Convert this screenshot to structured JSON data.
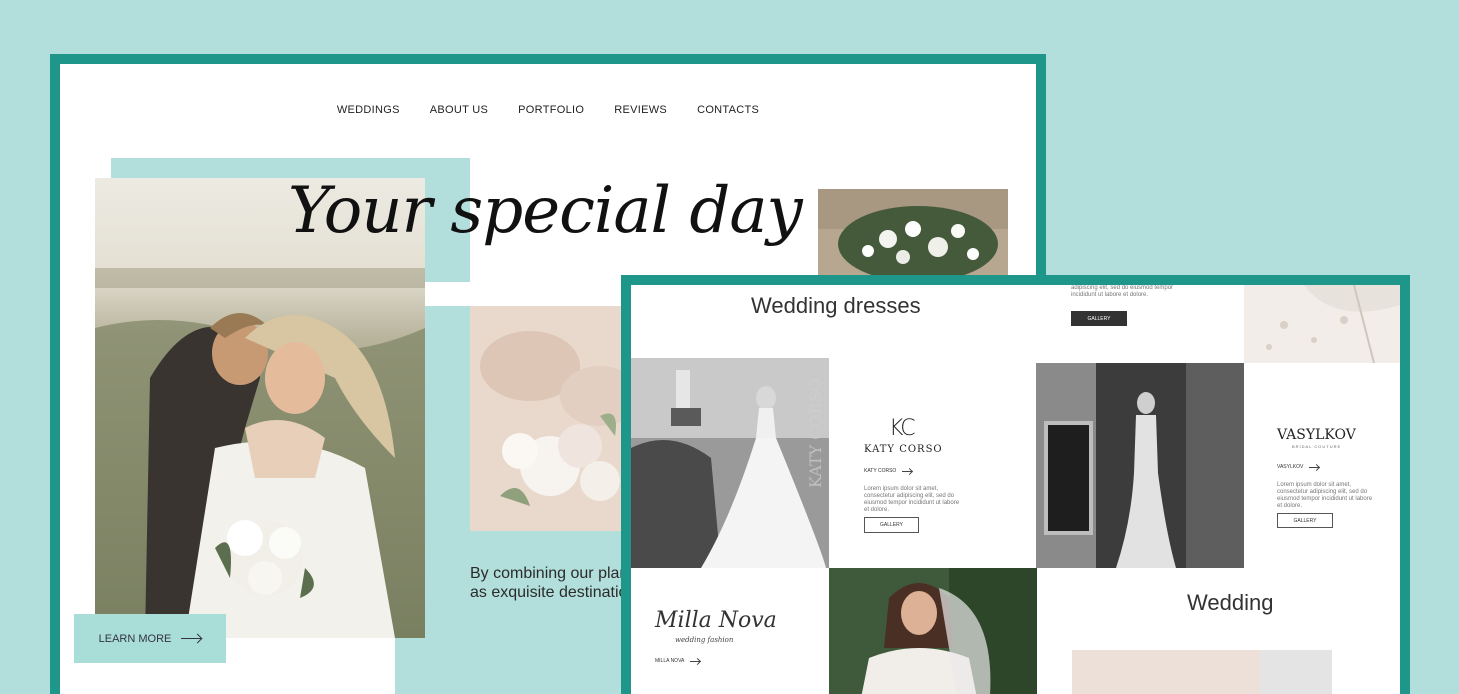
{
  "nav": {
    "items": [
      "WEDDINGS",
      "ABOUT US",
      "PORTFOLIO",
      "REVIEWS",
      "CONTACTS"
    ]
  },
  "hero": {
    "title": "Your special day",
    "intro": "By combining our plan vision, you can rest as exquisite destination",
    "learn_more": "LEARN MORE"
  },
  "dresses": {
    "title": "Wedding dresses",
    "top_lorem": "adipiscing elit, sed do eiusmod tempor incididunt ut labore et dolore.",
    "top_button": "GALLERY",
    "katy": {
      "logo_mark": "KC",
      "logo_name": "KATY CORSO",
      "link": "KATY CORSO",
      "text": "Lorem ipsum dolor sit amet, consectetur adipiscing elit, sed do eiusmod tempor incididunt ut labore et dolore.",
      "button": "GALLERY",
      "watermark": "KATY CORSO"
    },
    "vasylkov": {
      "logo_name": "VASYLKOV",
      "logo_sub": "BRIDAL COUTURE",
      "link": "VASYLKOV",
      "text": "Lorem ipsum dolor sit amet, consectetur adipiscing elit, sed do eiusmod tempor incididunt ut labore et dolore.",
      "button": "GALLERY"
    },
    "milla": {
      "logo_name": "Milla Nova",
      "logo_sub": "wedding fashion",
      "link": "MILLA NOVA"
    },
    "second_title": "Wedding"
  },
  "colors": {
    "background": "#b2dfdb",
    "frame": "#1f968a",
    "accent": "#a9ddd8"
  }
}
